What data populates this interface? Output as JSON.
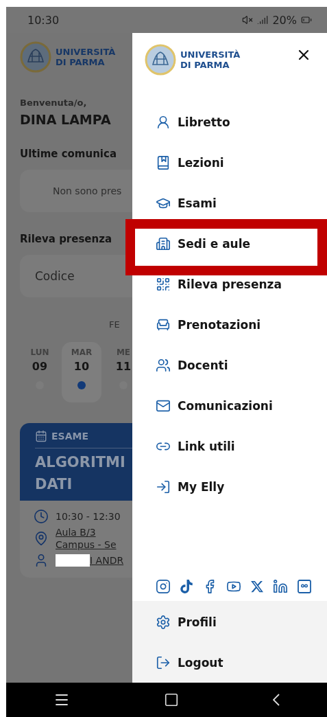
{
  "status_bar": {
    "time": "10:30",
    "battery": "20%"
  },
  "app": {
    "logo": {
      "line1": "UNIVERSITÀ",
      "line2": "DI PARMA"
    },
    "greeting": "Benvenuta/o,",
    "user_name": "DINA LAMPA",
    "communications": {
      "title": "Ultime comunica",
      "empty_text": "Non sono pres"
    },
    "attendance": {
      "title": "Rileva presenza",
      "placeholder": "Codice"
    },
    "calendar": {
      "month": "FE",
      "days": [
        {
          "weekday": "LUN",
          "day": "09",
          "selected": false
        },
        {
          "weekday": "MAR",
          "day": "10",
          "selected": true
        },
        {
          "weekday": "ME",
          "day": "11",
          "selected": false
        }
      ]
    },
    "event": {
      "type": "ESAME",
      "title_lines": [
        "ALGORITMI",
        "DATI"
      ],
      "time": "10:30 - 12:30",
      "room": "Aula B/3",
      "campus": "Campus - Se",
      "teacher": "I ANDR"
    }
  },
  "drawer": {
    "logo": {
      "line1": "UNIVERSITÀ",
      "line2": "DI PARMA"
    },
    "items": [
      {
        "label": "Libretto",
        "highlighted": false
      },
      {
        "label": "Lezioni",
        "highlighted": false
      },
      {
        "label": "Esami",
        "highlighted": false
      },
      {
        "label": "Sedi e aule",
        "highlighted": true
      },
      {
        "label": "Rileva presenza",
        "highlighted": false
      },
      {
        "label": "Prenotazioni",
        "highlighted": false
      },
      {
        "label": "Docenti",
        "highlighted": false
      },
      {
        "label": "Comunicazioni",
        "highlighted": false
      },
      {
        "label": "Link utili",
        "highlighted": false
      },
      {
        "label": "My Elly",
        "highlighted": false
      }
    ],
    "footer": [
      {
        "label": "Profili"
      },
      {
        "label": "Logout"
      }
    ]
  }
}
